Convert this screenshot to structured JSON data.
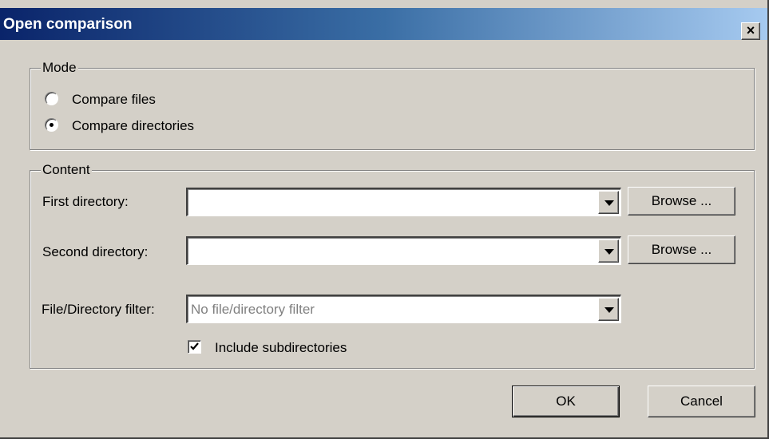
{
  "dialog": {
    "title": "Open comparison",
    "close_icon": "close-icon",
    "close_glyph": "×"
  },
  "mode": {
    "legend": "Mode",
    "options": [
      {
        "label": "Compare files",
        "selected": false
      },
      {
        "label": "Compare directories",
        "selected": true
      }
    ]
  },
  "content": {
    "legend": "Content",
    "first_directory": {
      "label": "First directory:",
      "value": "",
      "browse_label": "Browse ..."
    },
    "second_directory": {
      "label": "Second directory:",
      "value": "",
      "browse_label": "Browse ..."
    },
    "filter": {
      "label": "File/Directory filter:",
      "value": "No file/directory filter"
    },
    "include_subdirectories": {
      "label": "Include subdirectories",
      "checked": true
    }
  },
  "buttons": {
    "ok": "OK",
    "cancel": "Cancel"
  },
  "colors": {
    "titlebar_start": "#0a246a",
    "titlebar_end": "#a6caf0",
    "face": "#d4d0c8"
  }
}
